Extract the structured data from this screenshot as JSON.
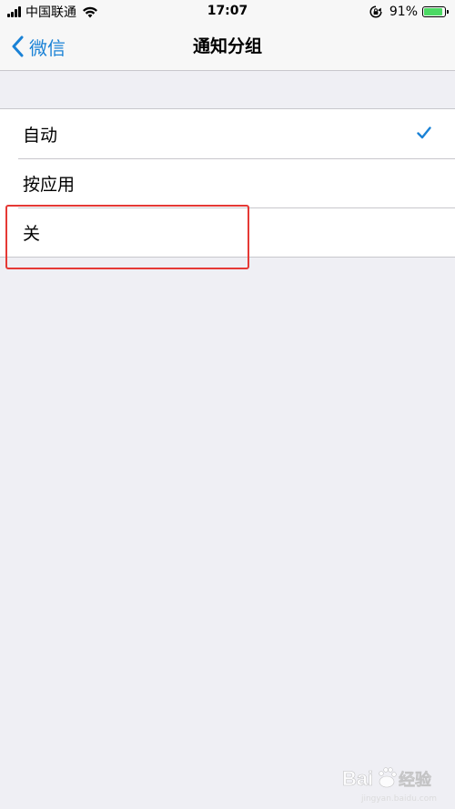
{
  "status_bar": {
    "carrier": "中国联通",
    "time": "17:07",
    "battery_percent": "91%",
    "battery_level": 0.91
  },
  "nav": {
    "back_label": "微信",
    "title": "通知分组"
  },
  "options": [
    {
      "label": "自动",
      "selected": true
    },
    {
      "label": "按应用",
      "selected": false
    },
    {
      "label": "关",
      "selected": false
    }
  ],
  "colors": {
    "accent": "#1a82d6",
    "highlight": "#e53935",
    "battery": "#4cd964",
    "background": "#efeff4"
  },
  "watermark": {
    "brand": "Baidu 经验",
    "sub": "jingyan.baidu.com"
  }
}
